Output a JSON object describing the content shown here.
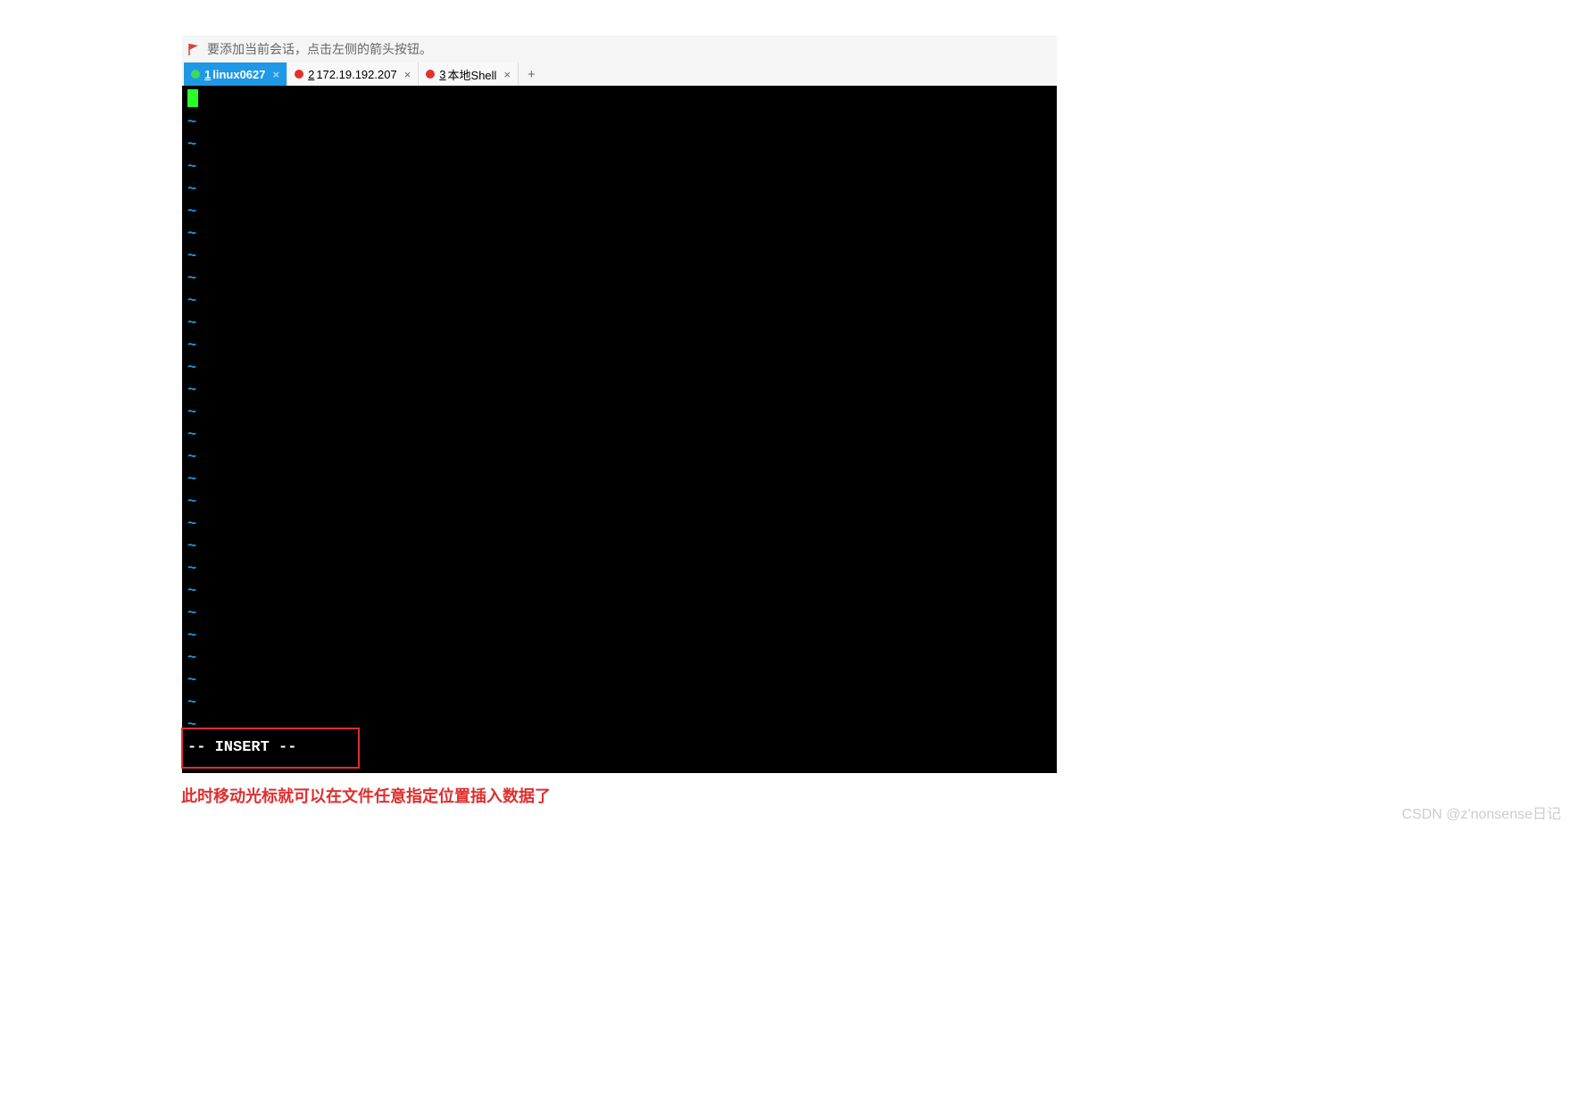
{
  "hint": {
    "text": "要添加当前会话，点击左侧的箭头按钮。"
  },
  "tabs": [
    {
      "num": "1",
      "label": "linux0627",
      "active": true,
      "dot": "green"
    },
    {
      "num": "2",
      "label": "172.19.192.207",
      "active": false,
      "dot": "red"
    },
    {
      "num": "3",
      "label": "本地Shell",
      "active": false,
      "dot": "red"
    }
  ],
  "terminal": {
    "tilde": "~",
    "insert_mode": "-- INSERT --",
    "tilde_rows": 28
  },
  "caption": "此时移动光标就可以在文件任意指定位置插入数据了",
  "watermark": "CSDN @z'nonsense日记"
}
